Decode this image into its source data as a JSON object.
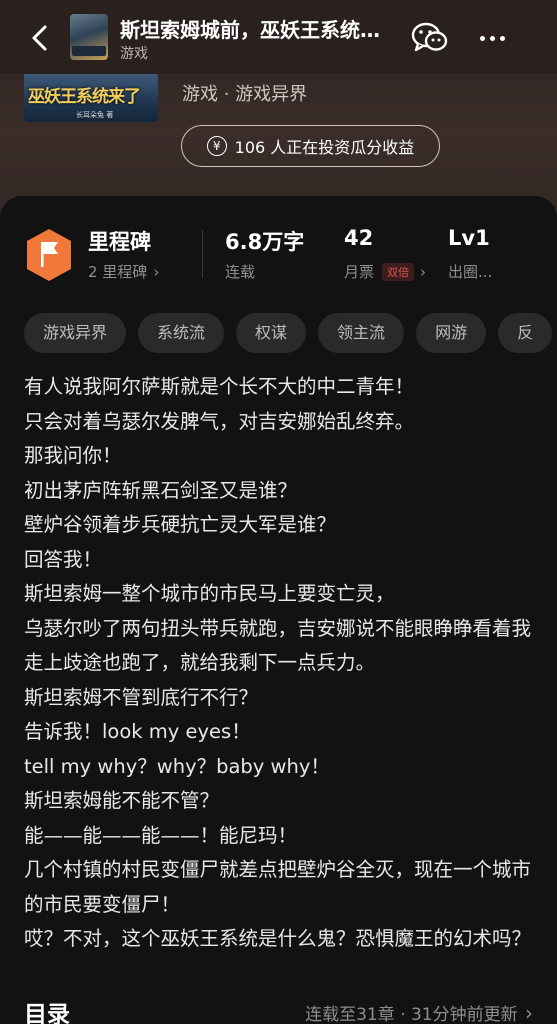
{
  "nav": {
    "title": "斯坦索姆城前，巫妖王系统来了",
    "subtitle": "游戏"
  },
  "book": {
    "cover_title": "巫妖王系统来了",
    "cover_author": "长耳朵兔 著",
    "category": "游戏 · 游戏异界",
    "invest_text": "106 人正在投资瓜分收益",
    "invest_icon": "yen-icon"
  },
  "stats": {
    "milestone": {
      "title": "里程碑",
      "sub": "2 里程碑"
    },
    "words": {
      "title": "6.8万字",
      "sub": "连载"
    },
    "tickets": {
      "title": "42",
      "sub": "月票",
      "badge": "双倍"
    },
    "level": {
      "title": "Lv1",
      "sub": "出圈..."
    }
  },
  "tags": [
    "游戏异界",
    "系统流",
    "权谋",
    "领主流",
    "网游",
    "反"
  ],
  "intro": [
    "有人说我阿尔萨斯就是个长不大的中二青年！",
    "只会对着乌瑟尔发脾气，对吉安娜始乱终弃。",
    "那我问你！",
    "初出茅庐阵斩黑石剑圣又是谁？",
    "壁炉谷领着步兵硬抗亡灵大军是谁？",
    "回答我！",
    "斯坦索姆一整个城市的市民马上要变亡灵，",
    "乌瑟尔吵了两句扭头带兵就跑，吉安娜说不能眼睁睁看着我走上歧途也跑了，就给我剩下一点兵力。",
    "斯坦索姆不管到底行不行？",
    "告诉我！look my eyes！",
    "tell my why？why？baby why！",
    "斯坦索姆能不能不管？",
    "能——能——能——！能尼玛！",
    "几个村镇的村民变僵尸就差点把壁炉谷全灭，现在一个城市的市民要变僵尸！",
    "哎？不对，这个巫妖王系统是什么鬼？恐惧魔王的幻术吗？"
  ],
  "toc": {
    "title": "目录",
    "status": "连载至31章 · 31分钟前更新"
  },
  "colors": {
    "accent_orange": "#f0793a",
    "badge_red": "#e0524f",
    "card_bg": "#121212"
  }
}
